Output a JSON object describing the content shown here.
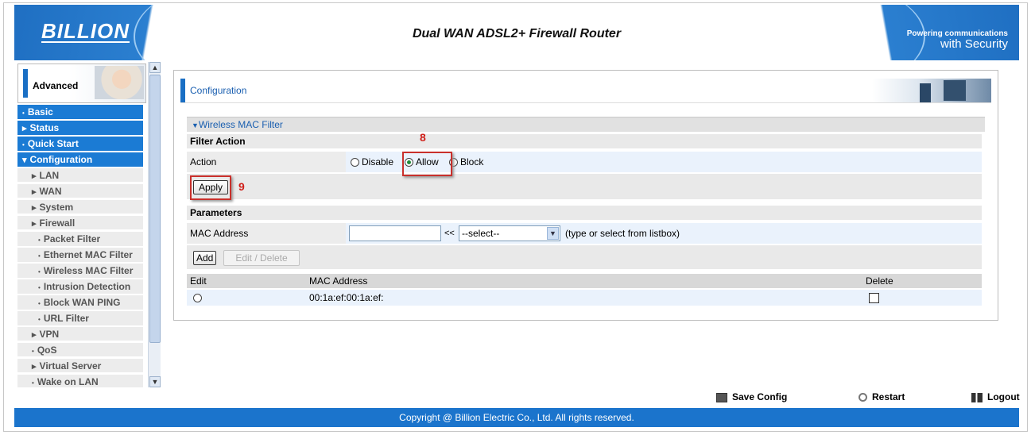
{
  "header": {
    "logo": "BILLION",
    "title": "Dual WAN ADSL2+ Firewall Router",
    "slogan_line1": "Powering communications",
    "slogan_line2": "with Security"
  },
  "sidebar": {
    "mode_label": "Advanced",
    "items": [
      {
        "label": "Basic",
        "level": "top"
      },
      {
        "label": "Status",
        "level": "top"
      },
      {
        "label": "Quick Start",
        "level": "top"
      },
      {
        "label": "Configuration",
        "level": "top"
      },
      {
        "label": "LAN",
        "level": "sub"
      },
      {
        "label": "WAN",
        "level": "sub"
      },
      {
        "label": "System",
        "level": "sub"
      },
      {
        "label": "Firewall",
        "level": "sub"
      },
      {
        "label": "Packet Filter",
        "level": "sub2"
      },
      {
        "label": "Ethernet MAC Filter",
        "level": "sub2"
      },
      {
        "label": "Wireless MAC Filter",
        "level": "sub2"
      },
      {
        "label": "Intrusion Detection",
        "level": "sub2"
      },
      {
        "label": "Block WAN PING",
        "level": "sub2"
      },
      {
        "label": "URL Filter",
        "level": "sub2"
      },
      {
        "label": "VPN",
        "level": "sub"
      },
      {
        "label": "QoS",
        "level": "sub"
      },
      {
        "label": "Virtual Server",
        "level": "sub"
      },
      {
        "label": "Wake on LAN",
        "level": "sub"
      }
    ]
  },
  "page": {
    "title": "Configuration",
    "section_title": "Wireless MAC Filter",
    "filter_action_label": "Filter Action",
    "action_label": "Action",
    "options": {
      "disable": "Disable",
      "allow": "Allow",
      "block": "Block"
    },
    "selected_action": "Allow",
    "apply_label": "Apply",
    "parameters_label": "Parameters",
    "mac_address_label": "MAC Address",
    "mac_input_value": "",
    "arrows": "<<",
    "select_value": "--select--",
    "listbox_hint": "(type or select from listbox)",
    "add_label": "Add",
    "edit_delete_label": "Edit / Delete",
    "table": {
      "headers": {
        "edit": "Edit",
        "mac": "MAC Address",
        "delete": "Delete"
      },
      "rows": [
        {
          "mac": "00:1a:ef:00:1a:ef:"
        }
      ]
    }
  },
  "annotations": {
    "step8": "8",
    "step9": "9"
  },
  "bottom": {
    "save_config": "Save Config",
    "restart": "Restart",
    "logout": "Logout",
    "copyright": "Copyright @ Billion Electric Co., Ltd. All rights reserved."
  }
}
